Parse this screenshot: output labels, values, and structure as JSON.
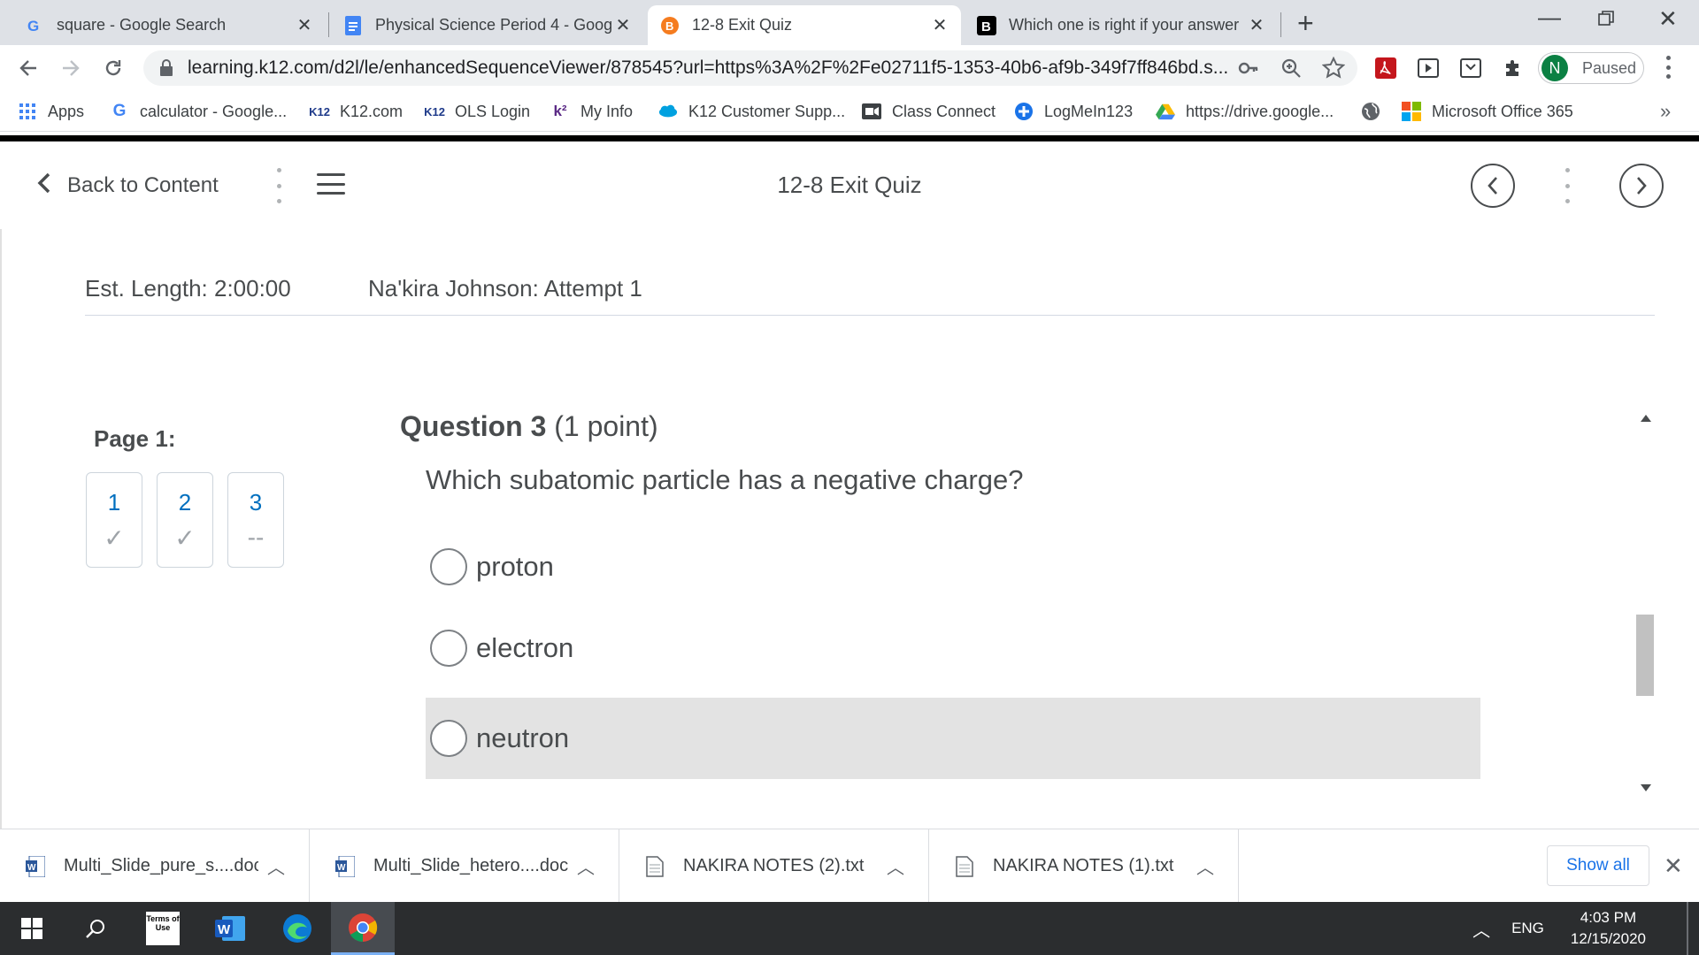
{
  "browser": {
    "tabs": [
      {
        "title": "square - Google Search",
        "icon": "google-icon"
      },
      {
        "title": "Physical Science Period 4 - Goog",
        "icon": "docs-icon"
      },
      {
        "title": "12-8 Exit Quiz",
        "icon": "brightspace-icon",
        "active": true
      },
      {
        "title": "Which one is right if your answer",
        "icon": "brainly-icon"
      }
    ],
    "url": "learning.k12.com/d2l/le/enhancedSequenceViewer/878545?url=https%3A%2F%2Fe02711f5-1353-40b6-af9b-349f7ff846bd.s...",
    "profile_initial": "N",
    "profile_status": "Paused",
    "bookmarks": [
      {
        "label": "Apps",
        "icon": "apps-grid-icon"
      },
      {
        "label": "calculator - Google...",
        "icon": "google-icon"
      },
      {
        "label": "K12.com",
        "icon": "k12-icon"
      },
      {
        "label": "OLS Login",
        "icon": "k12-icon"
      },
      {
        "label": "My Info",
        "icon": "k12-icon"
      },
      {
        "label": "K12 Customer Supp...",
        "icon": "salesforce-icon"
      },
      {
        "label": "Class Connect",
        "icon": "classconnect-icon"
      },
      {
        "label": "LogMeIn123",
        "icon": "logmein-icon"
      },
      {
        "label": "https://drive.google...",
        "icon": "drive-icon"
      },
      {
        "label": "",
        "icon": "globe-icon"
      },
      {
        "label": "Microsoft Office 365",
        "icon": "office-icon"
      }
    ]
  },
  "header": {
    "back_label": "Back to Content",
    "title": "12-8 Exit Quiz"
  },
  "quiz": {
    "est_length": "Est. Length: 2:00:00",
    "attempt": "Na'kira Johnson: Attempt 1",
    "page_label": "Page 1:",
    "questions_nav": [
      {
        "num": "1",
        "status": "✓"
      },
      {
        "num": "2",
        "status": "✓"
      },
      {
        "num": "3",
        "status": "--"
      }
    ],
    "question_number": "Question 3",
    "question_points": "(1 point)",
    "question_text": "Which subatomic particle has a negative charge?",
    "choices": [
      "proton",
      "electron",
      "neutron"
    ]
  },
  "downloads": [
    {
      "name": "Multi_Slide_pure_s....doc",
      "icon": "word-doc-icon"
    },
    {
      "name": "Multi_Slide_hetero....doc",
      "icon": "word-doc-icon"
    },
    {
      "name": "NAKIRA NOTES (2).txt",
      "icon": "text-file-icon"
    },
    {
      "name": "NAKIRA NOTES (1).txt",
      "icon": "text-file-icon"
    }
  ],
  "downloads_show_all": "Show all",
  "taskbar": {
    "terms_icon_text": "Terms of Use",
    "language": "ENG",
    "time": "4:03 PM",
    "date": "12/15/2020"
  },
  "colors": {
    "link_blue": "#006fbf",
    "text_gray": "#494c4e",
    "highlight_row": "#e3e3e3"
  }
}
